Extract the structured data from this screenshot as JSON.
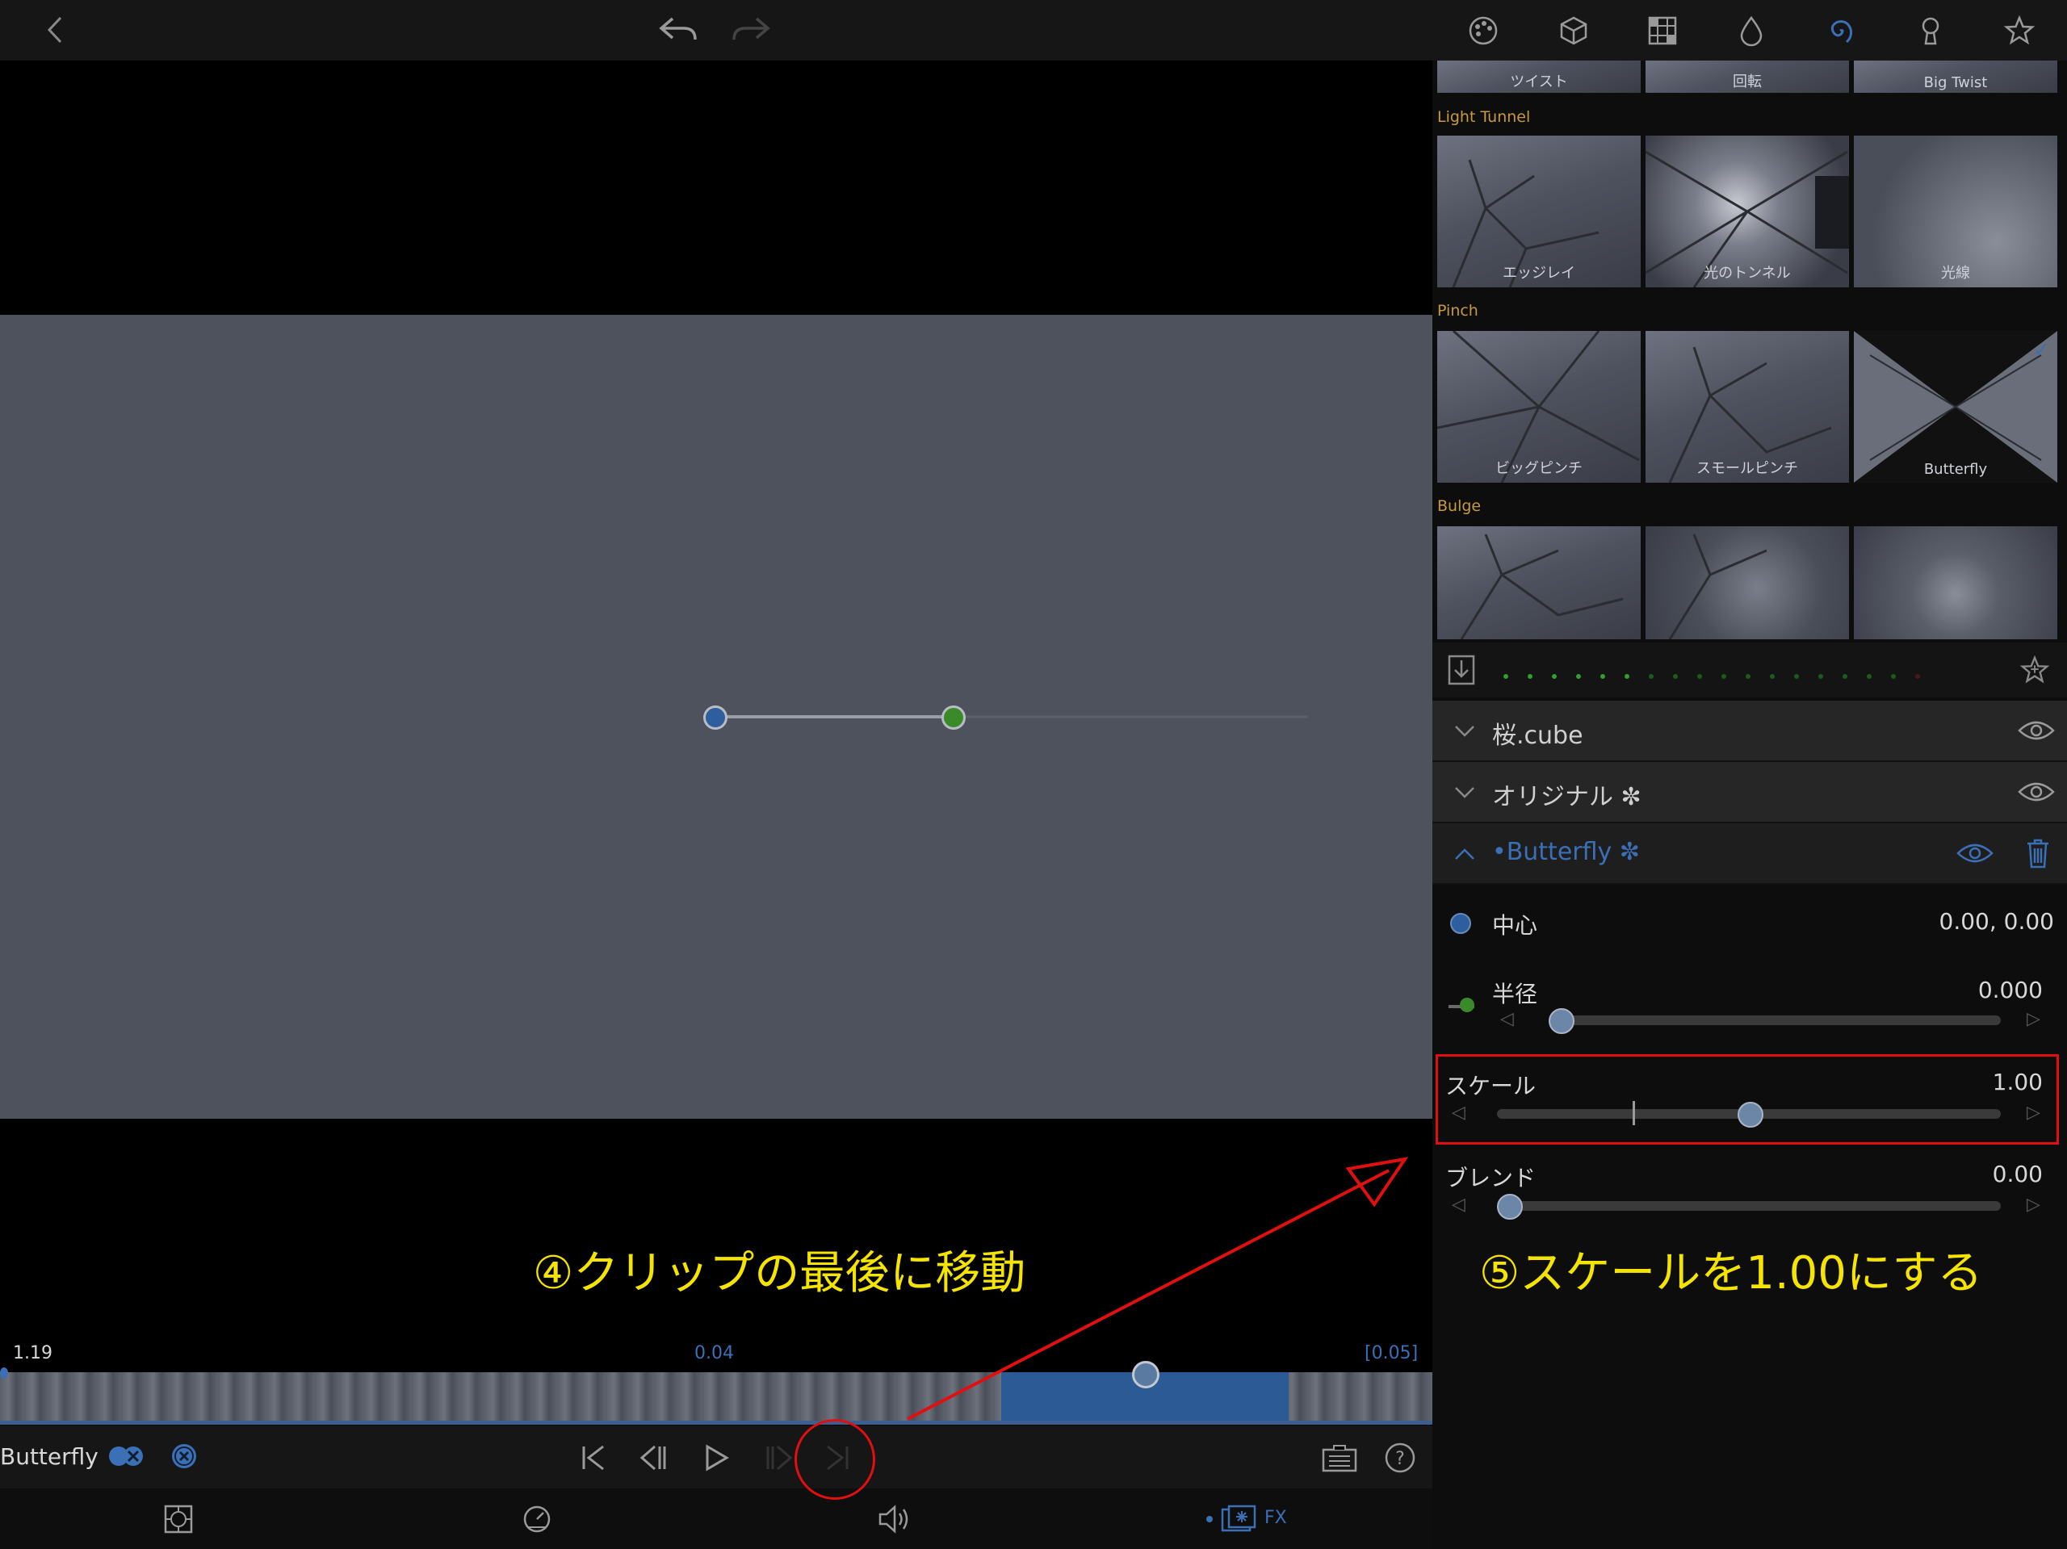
{
  "topbar": {
    "icons": [
      "back-chevron-icon",
      "undo-icon",
      "redo-icon"
    ]
  },
  "panel_tabs": [
    "palette-icon",
    "cube-icon",
    "grid-icon",
    "drop-icon",
    "swirl-icon",
    "keyhole-icon",
    "star-icon"
  ],
  "gallery": {
    "top_row": [
      "ツイスト",
      "回転",
      "Big Twist"
    ],
    "categories": [
      {
        "name": "Light Tunnel",
        "items": [
          "エッジレイ",
          "光のトンネル",
          "光線"
        ]
      },
      {
        "name": "Pinch",
        "items": [
          "ビッグピンチ",
          "スモールピンチ",
          "Butterfly"
        ]
      },
      {
        "name": "Bulge",
        "items": [
          "",
          "",
          ""
        ]
      }
    ]
  },
  "layers": [
    {
      "name": "桜.cube"
    },
    {
      "name": "オリジナル ✼"
    },
    {
      "name": "•Butterfly ✼"
    }
  ],
  "params": {
    "center": {
      "label": "中心",
      "value": "0.00, 0.00"
    },
    "radius": {
      "label": "半径",
      "value": "0.000",
      "fraction": 0.0
    },
    "scale": {
      "label": "スケール",
      "value": "1.00",
      "fraction": 0.5
    },
    "blend": {
      "label": "ブレンド",
      "value": "0.00",
      "fraction": 0.0
    }
  },
  "timeline": {
    "left_time": "1.19",
    "mid_time": "0.04",
    "right_time": "[0.05]"
  },
  "controls": {
    "effect_name": "Butterfly",
    "fx_label": "FX"
  },
  "annotations": {
    "step4": "④クリップの最後に移動",
    "step5": "⑤スケールを1.00にする"
  },
  "colors": {
    "accent_blue": "#3b6fb6",
    "highlight_red": "#e01010",
    "annotation_yellow": "#f5e400",
    "category_gold": "#c79a3a"
  }
}
